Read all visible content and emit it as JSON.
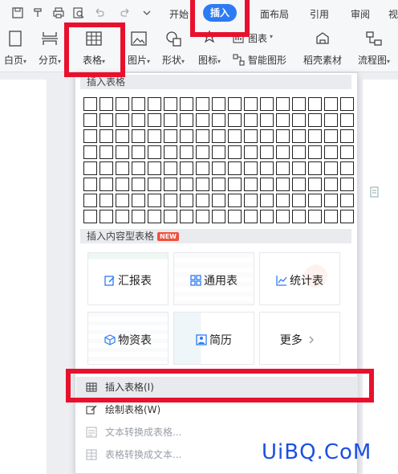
{
  "tabs": [
    {
      "label": "开始"
    },
    {
      "label": "插入"
    },
    {
      "label": "面布局"
    },
    {
      "label": "引用"
    },
    {
      "label": "审阅"
    },
    {
      "label": "视"
    }
  ],
  "ribbon": {
    "blank_page": "白页",
    "section": "分页",
    "table": "表格",
    "picture": "图片",
    "shape": "形状",
    "icon": "图标",
    "chart": "图表",
    "smart_art": "智能图形",
    "material": "稻壳素材",
    "flowchart": "流程图",
    "caret": "▾"
  },
  "dropdown": {
    "insert_table_title": "插入表格",
    "grid": {
      "rows": 8,
      "cols": 17
    },
    "content_table_title": "插入内容型表格",
    "new_badge": "NEW",
    "cards": [
      {
        "label": "汇报表",
        "icon": "edit-icon"
      },
      {
        "label": "通用表",
        "icon": "grid-icon"
      },
      {
        "label": "统计表",
        "icon": "line-chart-icon"
      },
      {
        "label": "物资表",
        "icon": "box-icon"
      },
      {
        "label": "简历",
        "icon": "person-icon"
      },
      {
        "label": "更多",
        "icon": "chevron-right-icon"
      }
    ],
    "menu": [
      {
        "label": "插入表格(I)",
        "enabled": true
      },
      {
        "label": "绘制表格(W)",
        "enabled": true
      },
      {
        "label": "文本转换成表格...",
        "enabled": false
      },
      {
        "label": "表格转换成文本...",
        "enabled": false
      }
    ]
  },
  "colors": {
    "accent": "#2d7bf4",
    "annotation": "#e8112d",
    "new_badge": "#f0503c"
  },
  "watermark": "UiBQ.CoM"
}
